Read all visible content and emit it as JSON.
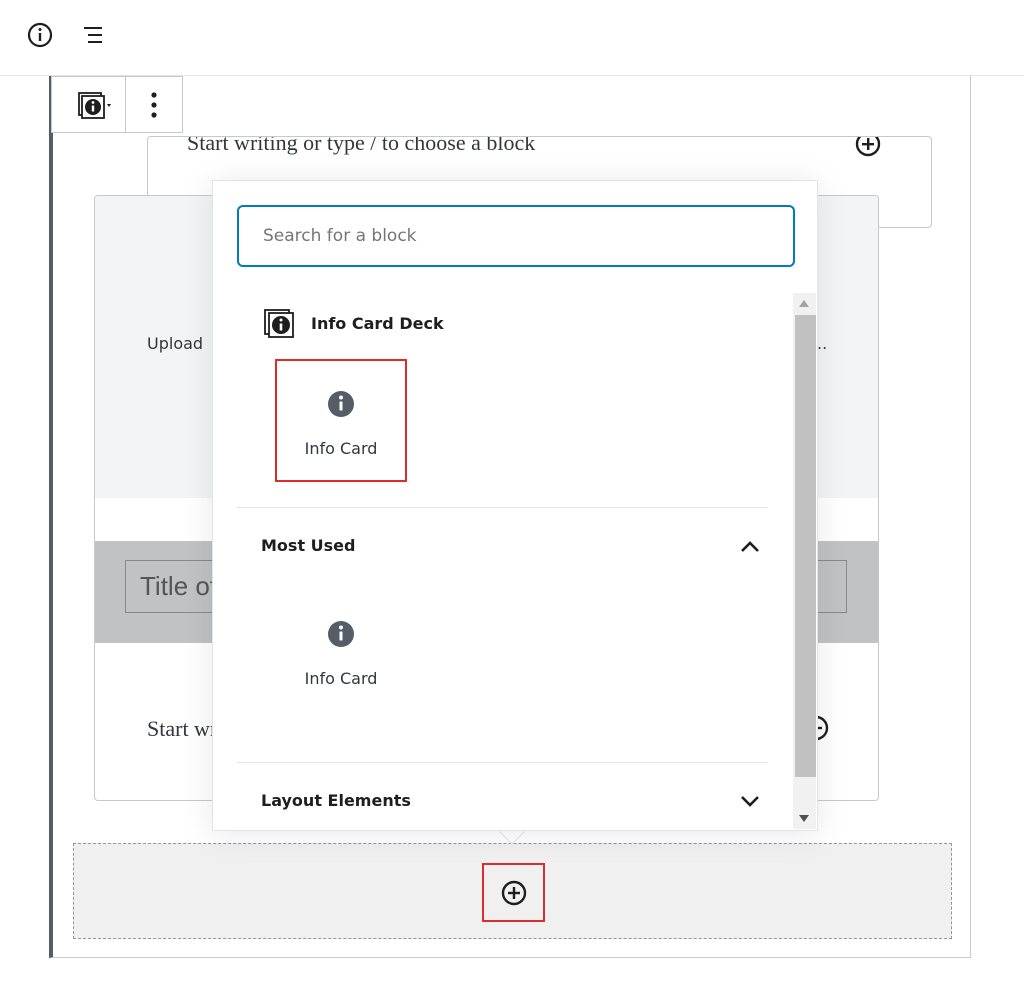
{
  "topbar": {
    "info_icon": "info-circle-icon",
    "outline_icon": "list-outline-icon"
  },
  "editor": {
    "paragraph_placeholder": "Start writing or type / to choose a block",
    "upload_text": "Upload",
    "upload_text_tail": "..",
    "title_placeholder": "Title of card",
    "card_paragraph_placeholder": "Start writing or type / to choose a block"
  },
  "toolbar": {
    "block_type_icon": "info-card-deck-icon",
    "more_icon": "vertical-ellipsis-icon"
  },
  "inserter": {
    "search_placeholder": "Search for a block",
    "reusable_section": {
      "title": "Info Card Deck",
      "icon": "info-card-deck-icon",
      "items": [
        {
          "label": "Info Card",
          "icon": "info-circle-filled-icon",
          "highlighted": true
        }
      ]
    },
    "most_used_section": {
      "title": "Most Used",
      "expanded": true,
      "items": [
        {
          "label": "Info Card",
          "icon": "info-circle-filled-icon"
        }
      ]
    },
    "layout_section": {
      "title": "Layout Elements",
      "expanded": false
    }
  },
  "appender": {
    "icon": "plus-circle-icon"
  },
  "colors": {
    "accent": "#007cba",
    "highlight": "#dd2c2c",
    "icon": "#555d66"
  }
}
